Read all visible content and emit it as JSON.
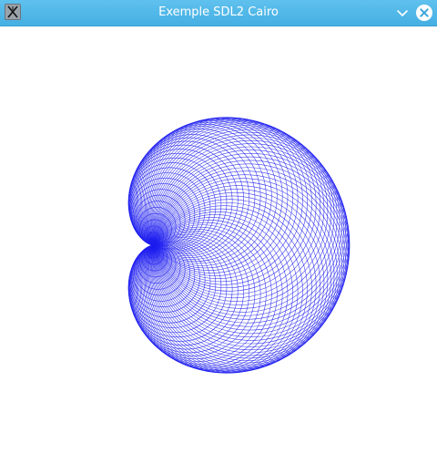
{
  "window": {
    "title": "Exemple SDL2 Cairo",
    "app_icon": "x11-app-icon",
    "controls": [
      "chevron-down-icon",
      "close-icon"
    ]
  },
  "drawing": {
    "shape": "cardioid envelope of circles",
    "stroke_color": "#1f1ff0",
    "background": "#ffffff",
    "circle_count": 96
  }
}
